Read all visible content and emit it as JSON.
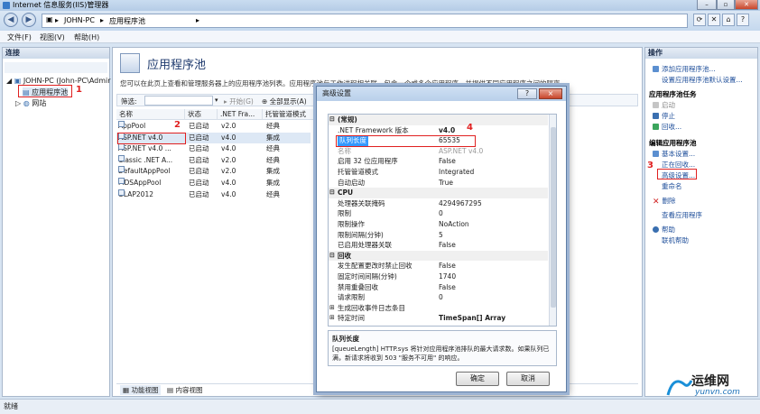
{
  "window": {
    "title": "Internet 信息服务(IIS)管理器"
  },
  "address": {
    "seg1": "JOHN-PC",
    "seg2": "应用程序池",
    "sep": "▸"
  },
  "menu": {
    "file": "文件(F)",
    "view": "视图(V)",
    "help": "帮助(H)"
  },
  "connections": {
    "title": "连接",
    "server": "JOHN-PC (John-PC\\Admir",
    "app_pools": "应用程序池",
    "sites": "网站"
  },
  "main": {
    "title": "应用程序池",
    "description": "您可以在此页上查看和管理服务器上的应用程序池列表。应用程序池与工作进程相关联，包含一个或多个应用程序，并提供不同应用程序之间的隔离。",
    "filter_label": "筛选:",
    "start_label": "开始(G)",
    "showall_label": "全部显示(A)",
    "group_label": "分",
    "columns": [
      "名称",
      "状态",
      ".NET Fra...",
      "托管管道模式"
    ],
    "rows": [
      {
        "name": "AppPool",
        "status": "已启动",
        "net": "v2.0",
        "mode": "经典"
      },
      {
        "name": "ASP.NET v4.0",
        "status": "已启动",
        "net": "v4.0",
        "mode": "集成"
      },
      {
        "name": "ASP.NET v4.0 ...",
        "status": "已启动",
        "net": "v4.0",
        "mode": "经典"
      },
      {
        "name": "Classic .NET A...",
        "status": "已启动",
        "net": "v2.0",
        "mode": "经典"
      },
      {
        "name": "DefaultAppPool",
        "status": "已启动",
        "net": "v2.0",
        "mode": "集成"
      },
      {
        "name": "MDSAppPool",
        "status": "已启动",
        "net": "v4.0",
        "mode": "集成"
      },
      {
        "name": "OLAP2012",
        "status": "已启动",
        "net": "v4.0",
        "mode": "经典"
      }
    ],
    "tab_features": "功能视图",
    "tab_content": "内容视图"
  },
  "dialog": {
    "title": "高级设置",
    "help_btn": "?",
    "close_btn": "×",
    "properties": [
      {
        "key": "(常规)",
        "value": "",
        "type": "cat"
      },
      {
        "key": ".NET Framework 版本",
        "value": "v4.0",
        "type": "bold"
      },
      {
        "key": "队列长度",
        "value": "65535",
        "type": "sel"
      },
      {
        "key": "名称",
        "value": "ASP.NET v4.0",
        "type": "dis"
      },
      {
        "key": "启用 32 位应用程序",
        "value": "False",
        "type": ""
      },
      {
        "key": "托管管道模式",
        "value": "Integrated",
        "type": ""
      },
      {
        "key": "自动启动",
        "value": "True",
        "type": ""
      },
      {
        "key": "CPU",
        "value": "",
        "type": "cat"
      },
      {
        "key": "处理器关联掩码",
        "value": "4294967295",
        "type": ""
      },
      {
        "key": "限制",
        "value": "0",
        "type": ""
      },
      {
        "key": "限制操作",
        "value": "NoAction",
        "type": ""
      },
      {
        "key": "限制间隔(分钟)",
        "value": "5",
        "type": ""
      },
      {
        "key": "已启用处理器关联",
        "value": "False",
        "type": ""
      },
      {
        "key": "回收",
        "value": "",
        "type": "cat"
      },
      {
        "key": "发生配置更改时禁止回收",
        "value": "False",
        "type": ""
      },
      {
        "key": "固定时间间隔(分钟)",
        "value": "1740",
        "type": ""
      },
      {
        "key": "禁用重叠回收",
        "value": "False",
        "type": ""
      },
      {
        "key": "请求限制",
        "value": "0",
        "type": ""
      },
      {
        "key": "生成回收事件日志条目",
        "value": "",
        "type": "expand"
      },
      {
        "key": "特定时间",
        "value": "TimeSpan[] Array",
        "type": "expandbold"
      }
    ],
    "desc_title": "队列长度",
    "desc_text": "[queueLength] HTTP.sys 将针对应用程序池排队的最大请求数。如果队列已满，新请求将收到 503 \"服务不可用\" 的响应。",
    "ok": "确定",
    "cancel": "取消"
  },
  "actions": {
    "title": "操作",
    "add_pool": "添加应用程序池...",
    "set_defaults": "设置应用程序池默认设置...",
    "tasks_head": "应用程序池任务",
    "start": "启动",
    "stop": "停止",
    "recycle": "回收...",
    "edit_head": "编辑应用程序池",
    "basic": "基本设置...",
    "recycling": "正在回收...",
    "advanced": "高级设置...",
    "rename": "重命名",
    "delete": "删除",
    "view_apps": "查看应用程序",
    "help": "帮助",
    "online_help": "联机帮助"
  },
  "annotations": {
    "n1": "1",
    "n2": "2",
    "n3": "3",
    "n4": "4"
  },
  "status": {
    "text": "就绪"
  },
  "watermark": {
    "brand": "运维网",
    "url": "yunvn.com"
  },
  "colors": {
    "accent": "#3399ff",
    "annotation": "#e02020"
  }
}
